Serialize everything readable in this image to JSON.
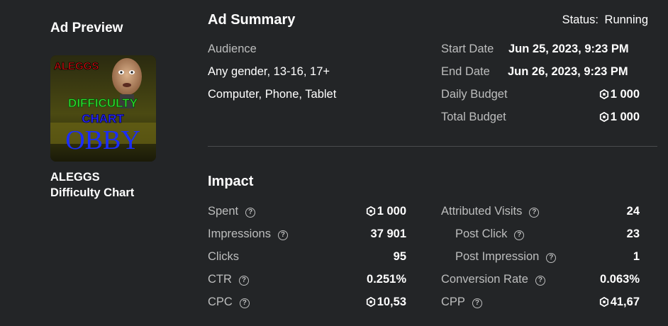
{
  "preview": {
    "heading": "Ad Preview",
    "thumb_text": {
      "top": "ALEGGS",
      "line1": "DIFFICULTY",
      "line2": "CHART",
      "line3": "OBBY"
    },
    "name_line1": "ALEGGS",
    "name_line2": "Difficulty Chart"
  },
  "summary": {
    "heading": "Ad Summary",
    "status_label": "Status:",
    "status_value": "Running",
    "audience_label": "Audience",
    "audience_value": "Any gender, 13-16, 17+",
    "devices_value": "Computer, Phone, Tablet",
    "start_label": "Start Date",
    "start_value": "Jun 25, 2023, 9:23 PM",
    "end_label": "End Date",
    "end_value": "Jun 26, 2023, 9:23 PM",
    "daily_label": "Daily Budget",
    "daily_value": "1 000",
    "total_label": "Total Budget",
    "total_value": "1 000"
  },
  "impact": {
    "heading": "Impact",
    "left": [
      {
        "label": "Spent",
        "value": "1 000",
        "robux": true,
        "help": true
      },
      {
        "label": "Impressions",
        "value": "37 901",
        "robux": false,
        "help": true
      },
      {
        "label": "Clicks",
        "value": "95",
        "robux": false,
        "help": false
      },
      {
        "label": "CTR",
        "value": "0.251%",
        "robux": false,
        "help": true
      },
      {
        "label": "CPC",
        "value": "10,53",
        "robux": true,
        "help": true
      }
    ],
    "right": [
      {
        "label": "Attributed Visits",
        "value": "24",
        "robux": false,
        "help": true
      },
      {
        "label": "Post Click",
        "value": "23",
        "robux": false,
        "help": true
      },
      {
        "label": "Post Impression",
        "value": "1",
        "robux": false,
        "help": true
      },
      {
        "label": "Conversion Rate",
        "value": "0.063%",
        "robux": false,
        "help": true
      },
      {
        "label": "CPP",
        "value": "41,67",
        "robux": true,
        "help": true
      }
    ]
  },
  "icons": {
    "help": "help-circle-icon",
    "currency": "robux-icon"
  },
  "colors": {
    "background": "#232527",
    "muted": "#bdbebe",
    "divider": "#4a4c4e"
  }
}
